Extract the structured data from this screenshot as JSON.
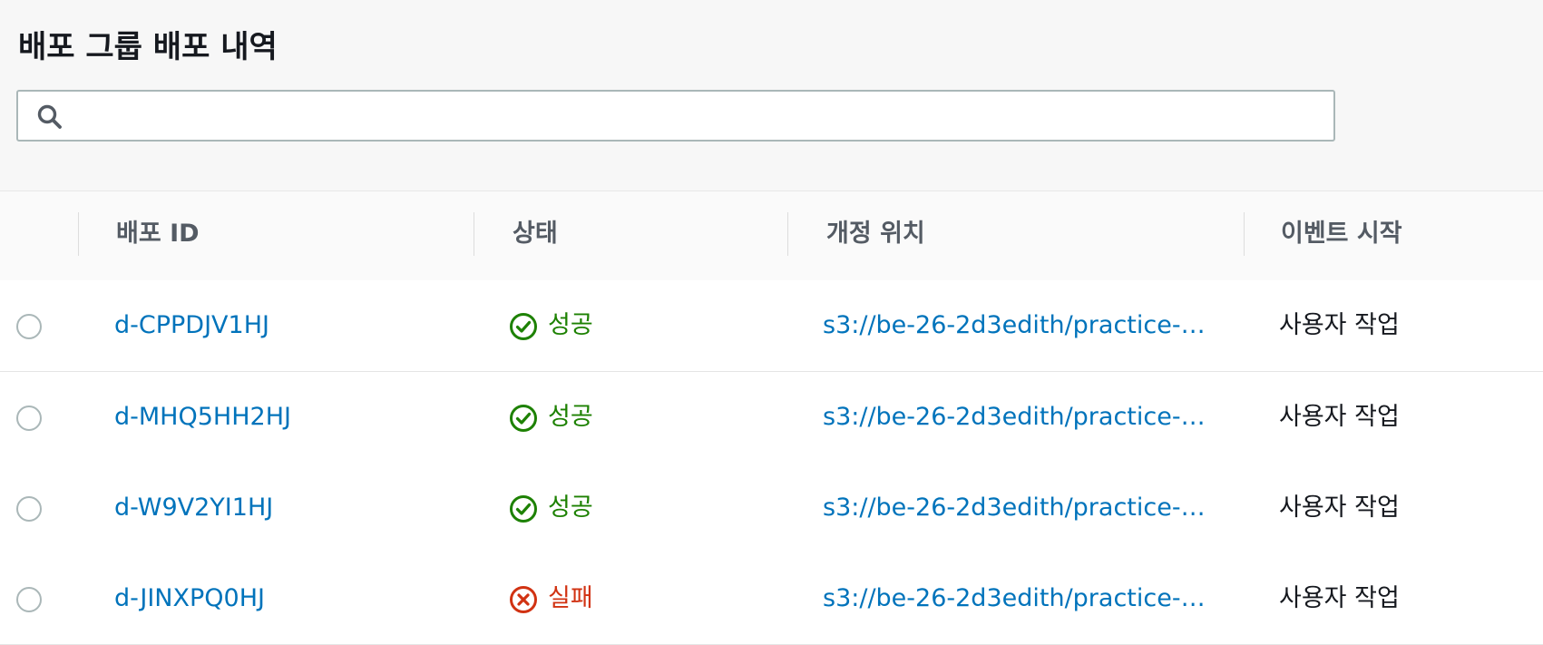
{
  "page": {
    "title": "배포 그룹 배포 내역"
  },
  "search": {
    "value": "",
    "placeholder": ""
  },
  "table": {
    "columns": [
      "배포 ID",
      "상태",
      "개정 위치",
      "이벤트 시작"
    ],
    "rows": [
      {
        "deployment_id": "d-CPPDJV1HJ",
        "status": "성공",
        "status_icon": "success-check-icon",
        "revision_location": "s3://be-26-2d3edith/practice-…",
        "event_start": "사용자 작업"
      },
      {
        "deployment_id": "d-MHQ5HH2HJ",
        "status": "성공",
        "status_icon": "success-check-icon",
        "revision_location": "s3://be-26-2d3edith/practice-…",
        "event_start": "사용자 작업"
      },
      {
        "deployment_id": "d-W9V2YI1HJ",
        "status": "성공",
        "status_icon": "success-check-icon",
        "revision_location": "s3://be-26-2d3edith/practice-…",
        "event_start": "사용자 작업"
      },
      {
        "deployment_id": "d-JINXPQ0HJ",
        "status": "실패",
        "status_icon": "failure-x-icon",
        "revision_location": "s3://be-26-2d3edith/practice-…",
        "event_start": "사용자 작업"
      }
    ]
  },
  "colors": {
    "link": "#0073bb",
    "success": "#1d8102",
    "failure": "#d13212",
    "header_bg": "#f7f7f7",
    "text": "#16191f"
  }
}
